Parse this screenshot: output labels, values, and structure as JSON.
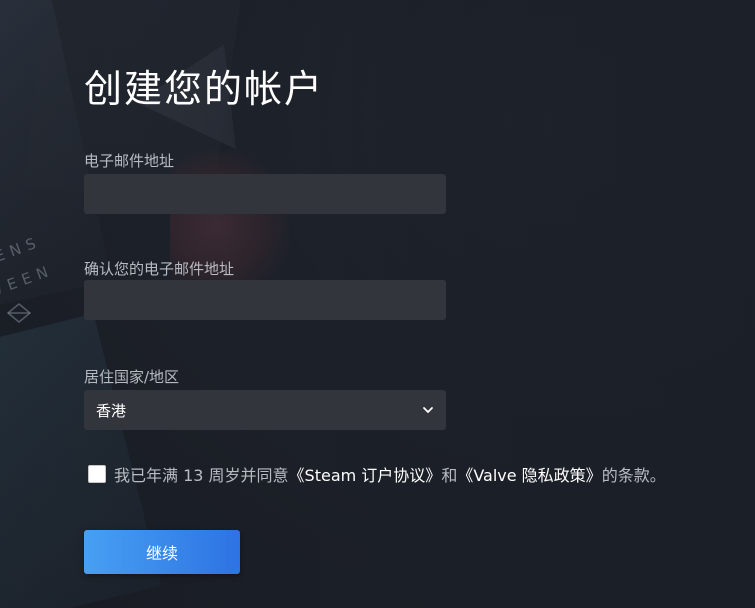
{
  "form": {
    "title": "创建您的帐户",
    "email_label": "电子邮件地址",
    "email_value": "",
    "confirm_email_label": "确认您的电子邮件地址",
    "confirm_email_value": "",
    "country_label": "居住国家/地区",
    "country_selected": "香港",
    "agreement": {
      "prefix": "我已年满 13 周岁并同意",
      "link_steam": "《Steam 订户协议》",
      "joiner": "和",
      "link_valve": "《Valve 隐私政策》",
      "suffix": "的条款。",
      "checked": false
    },
    "continue_label": "继续"
  },
  "background": {
    "art_text_1": "ENS",
    "art_text_2": "WEEN"
  },
  "colors": {
    "page_background": "#1b1f27",
    "input_background": "#32353c",
    "label_text": "#b8bcc2",
    "button_gradient_start": "#47a0f2",
    "button_gradient_end": "#2d73e3"
  },
  "icons": {
    "select_chevron": "chevron-down-icon"
  }
}
